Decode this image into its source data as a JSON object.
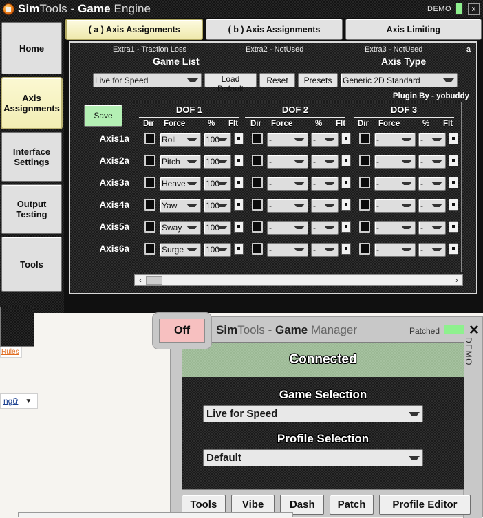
{
  "window": {
    "title_bold_1": "Sim",
    "title_thin_1": "Tools - ",
    "title_bold_2": "Game",
    "title_thin_2": " Engine",
    "demo_label": "DEMO",
    "close_label": "x",
    "app_icon": "simtools-logo-icon"
  },
  "sidebar": {
    "items": [
      {
        "label": "Home",
        "active": false
      },
      {
        "label": "Axis\nAssignments",
        "active": true
      },
      {
        "label": "Interface\nSettings",
        "active": false
      },
      {
        "label": "Output\nTesting",
        "active": false
      },
      {
        "label": "Tools",
        "active": false
      }
    ]
  },
  "tabs": [
    {
      "label": "( a ) Axis Assignments",
      "active": true
    },
    {
      "label": "( b ) Axis Assignments",
      "active": false
    },
    {
      "label": "Axis Limiting",
      "active": false
    }
  ],
  "panel": {
    "extra1": "Extra1 - Traction Loss",
    "extra2": "Extra2 - NotUsed",
    "extra3": "Extra3 - NotUsed",
    "corner_mark": "a",
    "game_list_title": "Game List",
    "game_list_value": "Live for Speed",
    "axis_type_title": "Axis Type",
    "axis_type_value": "Generic 2D Standard",
    "load_default_label": "Load Default",
    "reset_label": "Reset",
    "presets_label": "Presets",
    "plugin_by": "Plugin By - yobuddy",
    "save_label": "Save"
  },
  "grid": {
    "dof_headers": [
      "DOF 1",
      "DOF 2",
      "DOF 3"
    ],
    "column_headers": [
      "Dir",
      "Force",
      "%",
      "Flt"
    ],
    "rows": [
      {
        "axis": "Axis1a",
        "dof1": {
          "dir": false,
          "force": "Roll",
          "pct": "100",
          "flt": "."
        },
        "dof2": {
          "dir": false,
          "force": "-",
          "pct": "-",
          "flt": "."
        },
        "dof3": {
          "dir": false,
          "force": "-",
          "pct": "-",
          "flt": "."
        }
      },
      {
        "axis": "Axis2a",
        "dof1": {
          "dir": false,
          "force": "Pitch",
          "pct": "100",
          "flt": "."
        },
        "dof2": {
          "dir": false,
          "force": "-",
          "pct": "-",
          "flt": "."
        },
        "dof3": {
          "dir": false,
          "force": "-",
          "pct": "-",
          "flt": "."
        }
      },
      {
        "axis": "Axis3a",
        "dof1": {
          "dir": false,
          "force": "Heave",
          "pct": "100",
          "flt": "."
        },
        "dof2": {
          "dir": false,
          "force": "-",
          "pct": "-",
          "flt": "."
        },
        "dof3": {
          "dir": false,
          "force": "-",
          "pct": "-",
          "flt": "."
        }
      },
      {
        "axis": "Axis4a",
        "dof1": {
          "dir": false,
          "force": "Yaw",
          "pct": "100",
          "flt": "."
        },
        "dof2": {
          "dir": false,
          "force": "-",
          "pct": "-",
          "flt": "."
        },
        "dof3": {
          "dir": false,
          "force": "-",
          "pct": "-",
          "flt": "."
        }
      },
      {
        "axis": "Axis5a",
        "dof1": {
          "dir": false,
          "force": "Sway",
          "pct": "100",
          "flt": "."
        },
        "dof2": {
          "dir": false,
          "force": "-",
          "pct": "-",
          "flt": "."
        },
        "dof3": {
          "dir": false,
          "force": "-",
          "pct": "-",
          "flt": "."
        }
      },
      {
        "axis": "Axis6a",
        "dof1": {
          "dir": false,
          "force": "Surge",
          "pct": "100",
          "flt": "."
        },
        "dof2": {
          "dir": false,
          "force": "-",
          "pct": "-",
          "flt": "."
        },
        "dof3": {
          "dir": false,
          "force": "-",
          "pct": "-",
          "flt": "."
        }
      }
    ],
    "scroll_left": "‹",
    "scroll_right": "›"
  },
  "game_manager": {
    "title_bold_1": "Sim",
    "title_thin_1": "Tools - ",
    "title_bold_2": "Game",
    "title_thin_2": " Manager",
    "patched_label": "Patched",
    "close_label": "✕",
    "demo_label": "DEMO",
    "status": "Connected",
    "game_selection_title": "Game Selection",
    "game_selection_value": "Live for Speed",
    "profile_selection_title": "Profile Selection",
    "profile_selection_value": "Default",
    "off_button": "Off",
    "buttons": [
      "Tools",
      "Vibe",
      "Dash",
      "Patch",
      "Profile Editor"
    ]
  },
  "desktop": {
    "rules_link": "Rules",
    "lang_label": "ngữ",
    "lang_caret": "▼"
  },
  "colors": {
    "accent_yellow": "#f2eeb4",
    "status_green": "#9bb894",
    "save_green": "#b4f0b4",
    "off_pink": "#f7c0c0",
    "led_green": "#8ef08e",
    "carbon": "#1b1b1b"
  }
}
